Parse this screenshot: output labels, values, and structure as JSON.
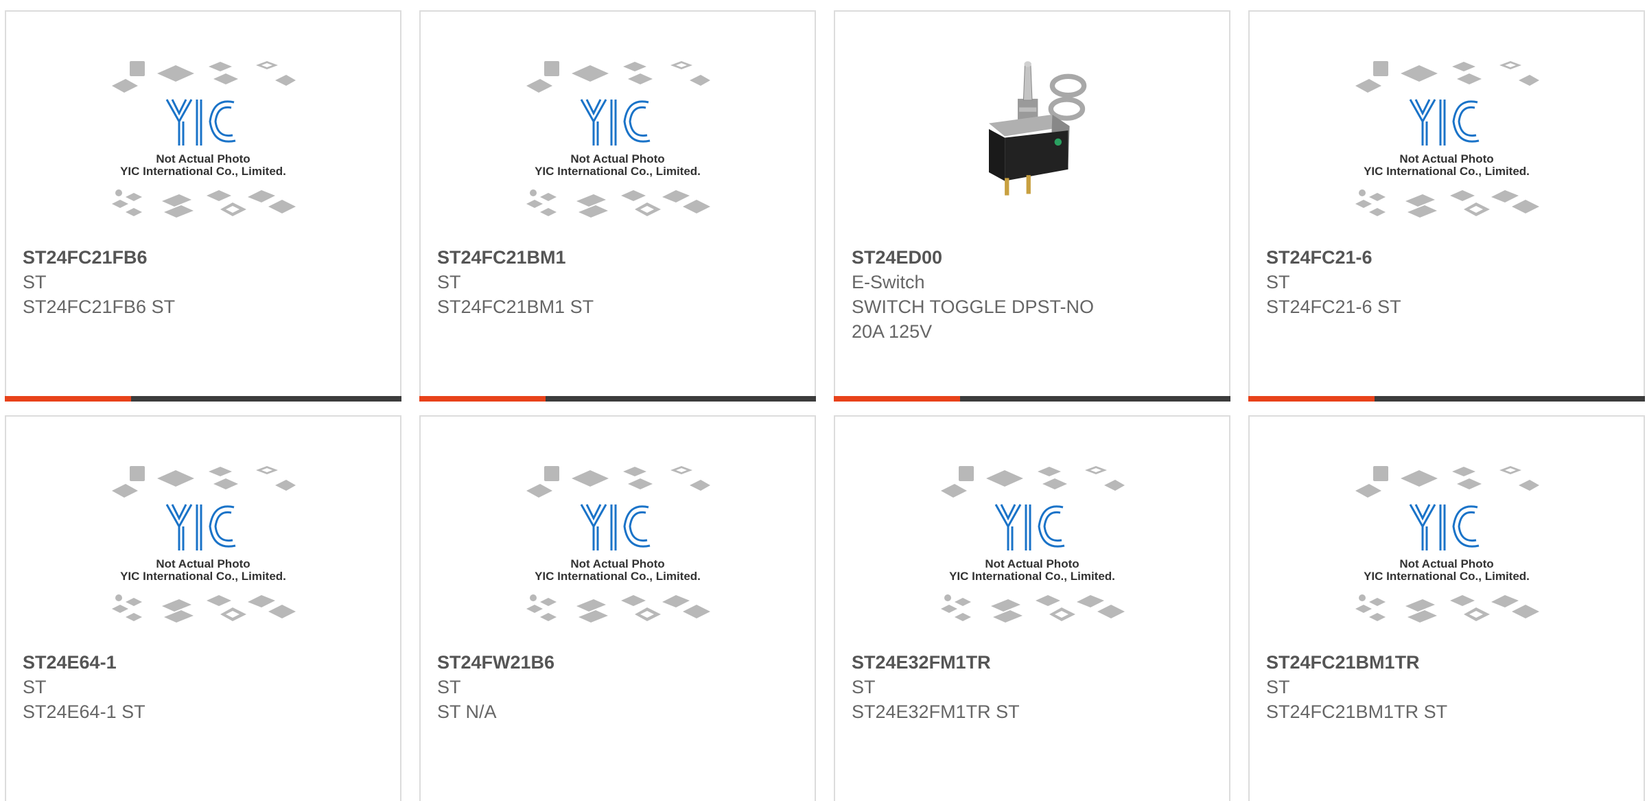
{
  "placeholder_image": {
    "line1": "Not Actual Photo",
    "line2": "YIC International Co., Limited.",
    "logo": "YIC"
  },
  "colors": {
    "accent": "#e8421a",
    "bar": "#3c3c3c",
    "logo_blue": "#1a73c8",
    "text": "#666666"
  },
  "products": [
    {
      "part_number": "ST24FC21FB6",
      "manufacturer": "ST",
      "description": "ST24FC21FB6 ST",
      "image": "placeholder"
    },
    {
      "part_number": "ST24FC21BM1",
      "manufacturer": "ST",
      "description": "ST24FC21BM1 ST",
      "image": "placeholder"
    },
    {
      "part_number": "ST24ED00",
      "manufacturer": "E-Switch",
      "description": "SWITCH TOGGLE DPST-NO 20A 125V",
      "image": "toggle-switch-photo"
    },
    {
      "part_number": "ST24FC21-6",
      "manufacturer": "ST",
      "description": "ST24FC21-6 ST",
      "image": "placeholder"
    },
    {
      "part_number": "ST24E64-1",
      "manufacturer": "ST",
      "description": "ST24E64-1 ST",
      "image": "placeholder"
    },
    {
      "part_number": "ST24FW21B6",
      "manufacturer": "ST",
      "description": "ST N/A",
      "image": "placeholder"
    },
    {
      "part_number": "ST24E32FM1TR",
      "manufacturer": "ST",
      "description": "ST24E32FM1TR ST",
      "image": "placeholder"
    },
    {
      "part_number": "ST24FC21BM1TR",
      "manufacturer": "ST",
      "description": "ST24FC21BM1TR ST",
      "image": "placeholder"
    }
  ]
}
